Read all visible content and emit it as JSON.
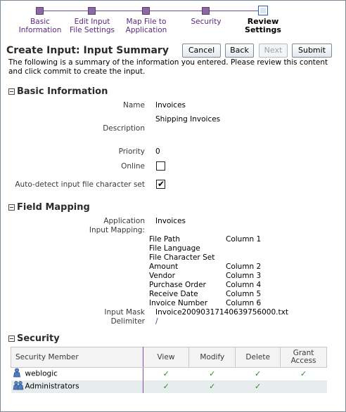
{
  "train": {
    "steps": [
      {
        "label": "Basic\nInformation"
      },
      {
        "label": "Edit Input\nFile Settings"
      },
      {
        "label": "Map File to\nApplication"
      },
      {
        "label": "Security"
      },
      {
        "label": "Review\nSettings"
      }
    ],
    "current_index": 4
  },
  "header": {
    "title": "Create Input: Input Summary",
    "buttons": {
      "cancel": "Cancel",
      "back": "Back",
      "next": "Next",
      "submit": "Submit"
    },
    "intro": "The following is a summary of the information you entered. Please review this content and click commit to create the input."
  },
  "basic": {
    "title": "Basic Information",
    "name_label": "Name",
    "name_value": "Invoices",
    "description_label": "Description",
    "description_value": "Shipping Invoices",
    "priority_label": "Priority",
    "priority_value": "0",
    "online_label": "Online",
    "online_checked": false,
    "autodetect_label": "Auto-detect input file character set",
    "autodetect_checked": true
  },
  "mapping": {
    "title": "Field Mapping",
    "application_label": "Application",
    "application_value": "Invoices",
    "input_mapping_label": "Input Mapping:",
    "rows": [
      {
        "field": "File Path",
        "column": "Column 1"
      },
      {
        "field": "File Language",
        "column": ""
      },
      {
        "field": "File Character Set",
        "column": ""
      },
      {
        "field": "Amount",
        "column": "Column 2"
      },
      {
        "field": "Vendor",
        "column": "Column 3"
      },
      {
        "field": "Purchase Order",
        "column": "Column 4"
      },
      {
        "field": "Receive Date",
        "column": "Column 5"
      },
      {
        "field": "Invoice Number",
        "column": "Column 6"
      }
    ],
    "input_mask_label": "Input Mask",
    "input_mask_value": "Invoice20090317140639756000.txt",
    "delimiter_label": "Delimiter",
    "delimiter_value": "/"
  },
  "security": {
    "title": "Security",
    "columns": [
      "Security Member",
      "View",
      "Modify",
      "Delete",
      "Grant Access"
    ],
    "rows": [
      {
        "member": "weblogic",
        "icon": "user-icon",
        "view": true,
        "modify": true,
        "delete": true,
        "grant": true
      },
      {
        "member": "Administrators",
        "icon": "group-icon",
        "view": true,
        "modify": true,
        "delete": true,
        "grant": false
      }
    ],
    "check_glyph": "✓"
  },
  "colors": {
    "train_purple": "#5a2a7a",
    "check_green": "#2a8a2a"
  }
}
